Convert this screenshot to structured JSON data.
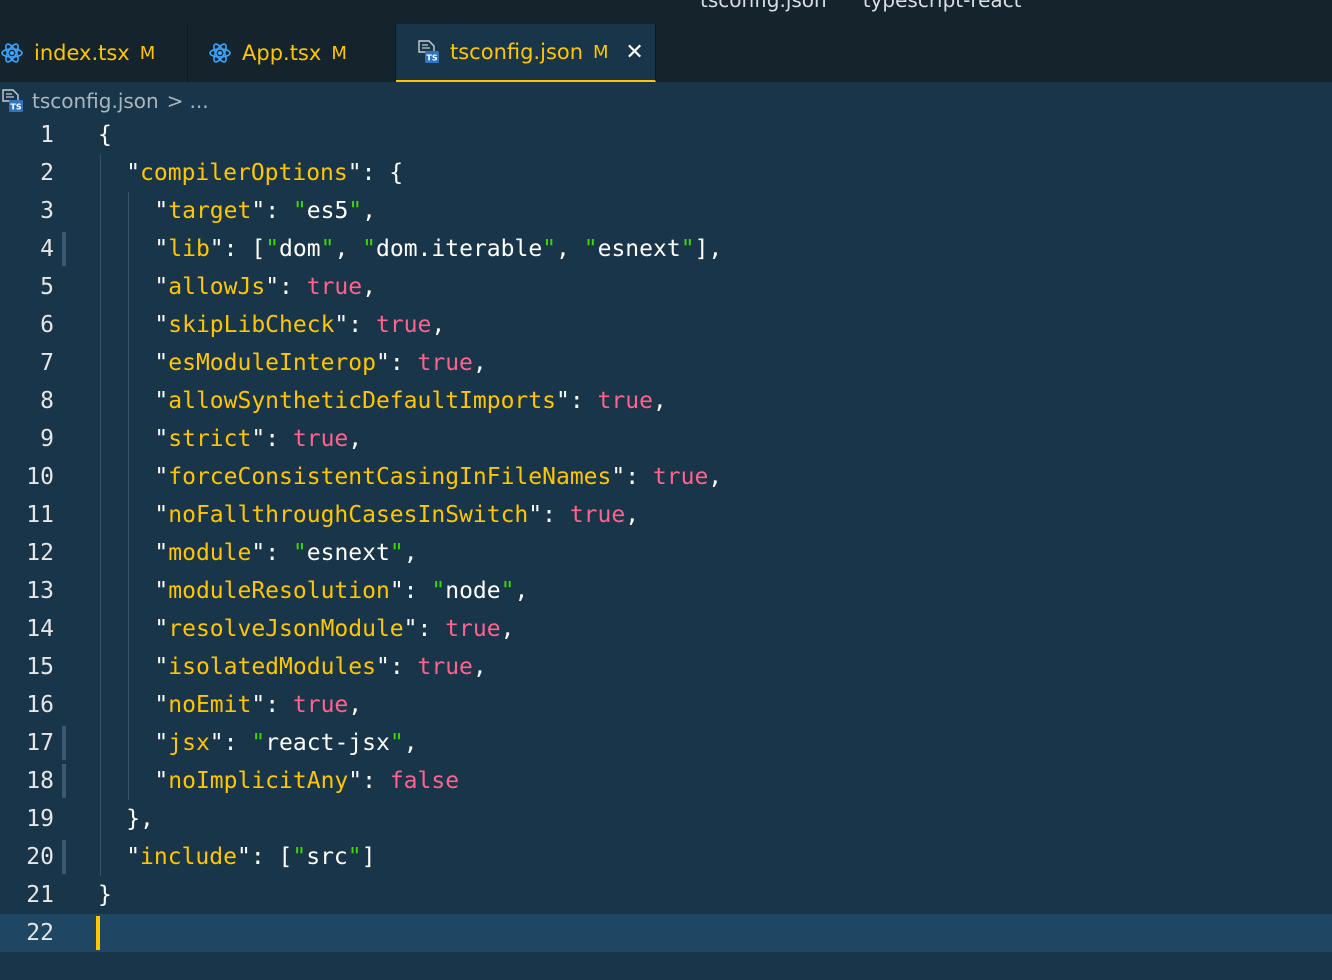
{
  "window": {
    "title_file": "tsconfig.json",
    "title_project": "typescript-react"
  },
  "tabs": [
    {
      "label": "index.tsx",
      "badge": "M",
      "icon": "react-icon",
      "active": false
    },
    {
      "label": "App.tsx",
      "badge": "M",
      "icon": "react-icon",
      "active": false
    },
    {
      "label": "tsconfig.json",
      "badge": "M",
      "icon": "typescript-config-icon",
      "active": true,
      "close": "✕"
    }
  ],
  "breadcrumb": {
    "file": "tsconfig.json",
    "separator": ">",
    "more": "..."
  },
  "editor": {
    "cursor_line": 22,
    "modified_lines": [
      4,
      17,
      18,
      20
    ],
    "lines": [
      {
        "n": "1",
        "indent": 0,
        "tokens": [
          [
            "p",
            "{"
          ]
        ]
      },
      {
        "n": "2",
        "indent": 1,
        "tokens": [
          [
            "p",
            "\""
          ],
          [
            "k",
            "compilerOptions"
          ],
          [
            "p",
            "\": {"
          ]
        ]
      },
      {
        "n": "3",
        "indent": 2,
        "tokens": [
          [
            "p",
            "\""
          ],
          [
            "k",
            "target"
          ],
          [
            "p",
            "\": "
          ],
          [
            "q",
            "\""
          ],
          [
            "s",
            "es5"
          ],
          [
            "q",
            "\""
          ],
          [
            "p",
            ","
          ]
        ]
      },
      {
        "n": "4",
        "indent": 2,
        "tokens": [
          [
            "p",
            "\""
          ],
          [
            "k",
            "lib"
          ],
          [
            "p",
            "\": ["
          ],
          [
            "q",
            "\""
          ],
          [
            "s",
            "dom"
          ],
          [
            "q",
            "\""
          ],
          [
            "p",
            ", "
          ],
          [
            "q",
            "\""
          ],
          [
            "s",
            "dom.iterable"
          ],
          [
            "q",
            "\""
          ],
          [
            "p",
            ", "
          ],
          [
            "q",
            "\""
          ],
          [
            "s",
            "esnext"
          ],
          [
            "q",
            "\""
          ],
          [
            "p",
            "],"
          ]
        ]
      },
      {
        "n": "5",
        "indent": 2,
        "tokens": [
          [
            "p",
            "\""
          ],
          [
            "k",
            "allowJs"
          ],
          [
            "p",
            "\": "
          ],
          [
            "b",
            "true"
          ],
          [
            "p",
            ","
          ]
        ]
      },
      {
        "n": "6",
        "indent": 2,
        "tokens": [
          [
            "p",
            "\""
          ],
          [
            "k",
            "skipLibCheck"
          ],
          [
            "p",
            "\": "
          ],
          [
            "b",
            "true"
          ],
          [
            "p",
            ","
          ]
        ]
      },
      {
        "n": "7",
        "indent": 2,
        "tokens": [
          [
            "p",
            "\""
          ],
          [
            "k",
            "esModuleInterop"
          ],
          [
            "p",
            "\": "
          ],
          [
            "b",
            "true"
          ],
          [
            "p",
            ","
          ]
        ]
      },
      {
        "n": "8",
        "indent": 2,
        "tokens": [
          [
            "p",
            "\""
          ],
          [
            "k",
            "allowSyntheticDefaultImports"
          ],
          [
            "p",
            "\": "
          ],
          [
            "b",
            "true"
          ],
          [
            "p",
            ","
          ]
        ]
      },
      {
        "n": "9",
        "indent": 2,
        "tokens": [
          [
            "p",
            "\""
          ],
          [
            "k",
            "strict"
          ],
          [
            "p",
            "\": "
          ],
          [
            "b",
            "true"
          ],
          [
            "p",
            ","
          ]
        ]
      },
      {
        "n": "10",
        "indent": 2,
        "tokens": [
          [
            "p",
            "\""
          ],
          [
            "k",
            "forceConsistentCasingInFileNames"
          ],
          [
            "p",
            "\": "
          ],
          [
            "b",
            "true"
          ],
          [
            "p",
            ","
          ]
        ]
      },
      {
        "n": "11",
        "indent": 2,
        "tokens": [
          [
            "p",
            "\""
          ],
          [
            "k",
            "noFallthroughCasesInSwitch"
          ],
          [
            "p",
            "\": "
          ],
          [
            "b",
            "true"
          ],
          [
            "p",
            ","
          ]
        ]
      },
      {
        "n": "12",
        "indent": 2,
        "tokens": [
          [
            "p",
            "\""
          ],
          [
            "k",
            "module"
          ],
          [
            "p",
            "\": "
          ],
          [
            "q",
            "\""
          ],
          [
            "s",
            "esnext"
          ],
          [
            "q",
            "\""
          ],
          [
            "p",
            ","
          ]
        ]
      },
      {
        "n": "13",
        "indent": 2,
        "tokens": [
          [
            "p",
            "\""
          ],
          [
            "k",
            "moduleResolution"
          ],
          [
            "p",
            "\": "
          ],
          [
            "q",
            "\""
          ],
          [
            "s",
            "node"
          ],
          [
            "q",
            "\""
          ],
          [
            "p",
            ","
          ]
        ]
      },
      {
        "n": "14",
        "indent": 2,
        "tokens": [
          [
            "p",
            "\""
          ],
          [
            "k",
            "resolveJsonModule"
          ],
          [
            "p",
            "\": "
          ],
          [
            "b",
            "true"
          ],
          [
            "p",
            ","
          ]
        ]
      },
      {
        "n": "15",
        "indent": 2,
        "tokens": [
          [
            "p",
            "\""
          ],
          [
            "k",
            "isolatedModules"
          ],
          [
            "p",
            "\": "
          ],
          [
            "b",
            "true"
          ],
          [
            "p",
            ","
          ]
        ]
      },
      {
        "n": "16",
        "indent": 2,
        "tokens": [
          [
            "p",
            "\""
          ],
          [
            "k",
            "noEmit"
          ],
          [
            "p",
            "\": "
          ],
          [
            "b",
            "true"
          ],
          [
            "p",
            ","
          ]
        ]
      },
      {
        "n": "17",
        "indent": 2,
        "tokens": [
          [
            "p",
            "\""
          ],
          [
            "k",
            "jsx"
          ],
          [
            "p",
            "\": "
          ],
          [
            "q",
            "\""
          ],
          [
            "s",
            "react-jsx"
          ],
          [
            "q",
            "\""
          ],
          [
            "p",
            ","
          ]
        ]
      },
      {
        "n": "18",
        "indent": 2,
        "tokens": [
          [
            "p",
            "\""
          ],
          [
            "k",
            "noImplicitAny"
          ],
          [
            "p",
            "\": "
          ],
          [
            "b",
            "false"
          ]
        ]
      },
      {
        "n": "19",
        "indent": 1,
        "tokens": [
          [
            "p",
            "},"
          ]
        ]
      },
      {
        "n": "20",
        "indent": 1,
        "tokens": [
          [
            "p",
            "\""
          ],
          [
            "k",
            "include"
          ],
          [
            "p",
            "\": ["
          ],
          [
            "q",
            "\""
          ],
          [
            "s",
            "src"
          ],
          [
            "q",
            "\""
          ],
          [
            "p",
            "]"
          ]
        ]
      },
      {
        "n": "21",
        "indent": 0,
        "tokens": [
          [
            "p",
            "}"
          ]
        ]
      },
      {
        "n": "22",
        "indent": 0,
        "tokens": []
      }
    ]
  },
  "colors": {
    "background": "#193549",
    "tabbar": "#15232d",
    "accent": "#ffc600",
    "key": "#ffc600",
    "string": "#ffffff",
    "string_quote": "#3ad900",
    "boolean": "#ff628c",
    "current_line": "#1f4662"
  }
}
